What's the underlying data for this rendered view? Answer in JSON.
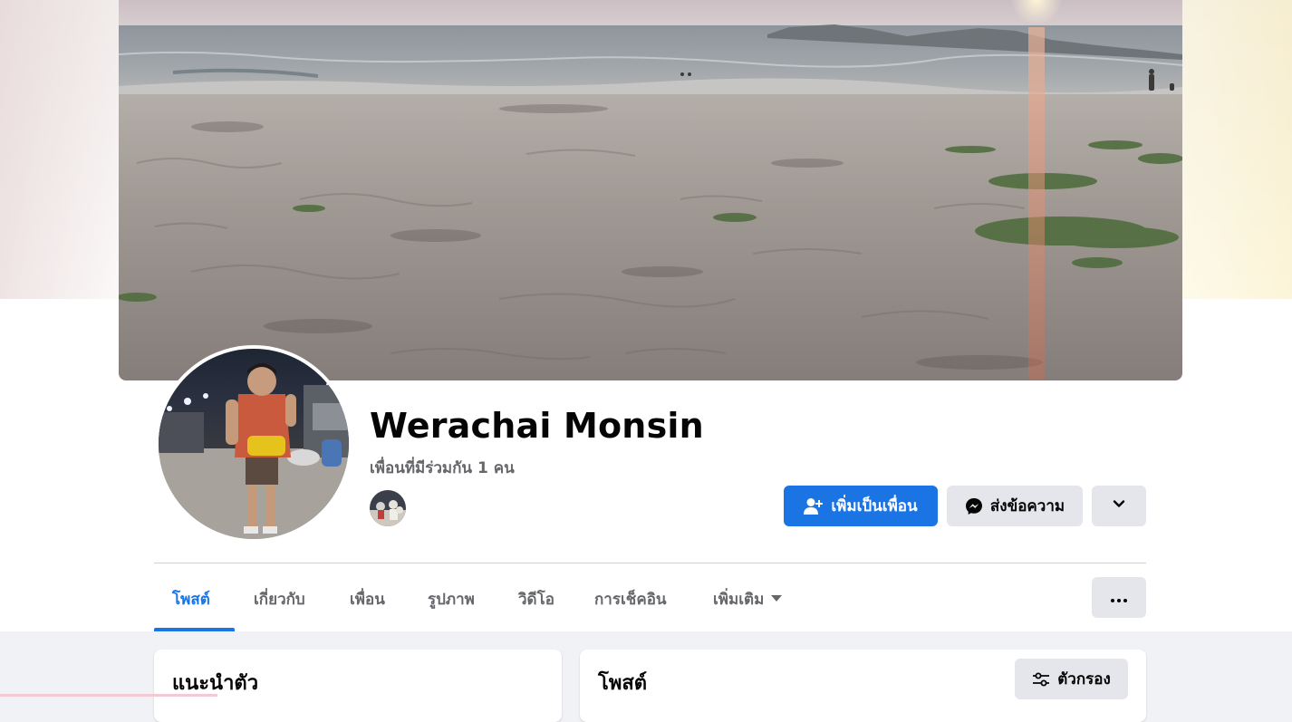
{
  "profile": {
    "name": "Werachai Monsin",
    "mutual_friends": "เพื่อนที่มีร่วมกัน 1 คน"
  },
  "actions": {
    "add_friend": "เพิ่มเป็นเพื่อน",
    "message": "ส่งข้อความ"
  },
  "tabs": [
    {
      "label": "โพสต์",
      "active": true
    },
    {
      "label": "เกี่ยวกับ"
    },
    {
      "label": "เพื่อน"
    },
    {
      "label": "รูปภาพ"
    },
    {
      "label": "วิดีโอ"
    },
    {
      "label": "การเช็คอิน"
    },
    {
      "label": "เพิ่มเติม"
    }
  ],
  "intro": {
    "title": "แนะนำตัว"
  },
  "posts": {
    "title": "โพสต์",
    "filter_label": "ตัวกรอง"
  },
  "icons": {
    "add_friend": "person-plus-icon",
    "message": "messenger-icon",
    "more": "chevron-down-icon",
    "tabs_more": "caret-down-icon",
    "options": "three-dots-icon",
    "filter": "sliders-icon"
  },
  "colors": {
    "primary": "#1b74e4",
    "secondary_button": "#e4e6eb",
    "muted_text": "#65676b",
    "page_background": "#f0f2f5"
  }
}
